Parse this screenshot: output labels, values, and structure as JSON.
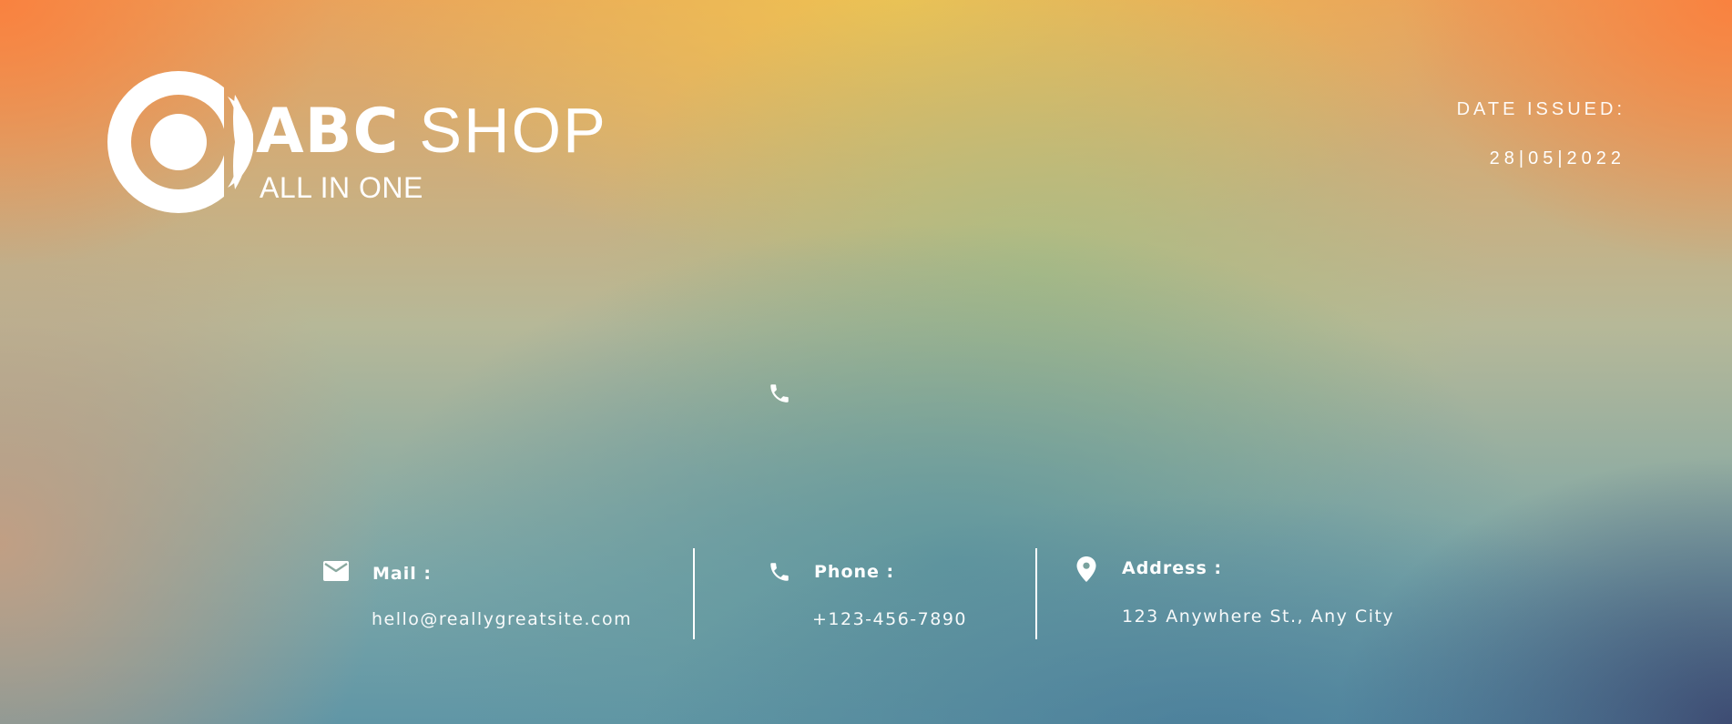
{
  "brand": {
    "name_bold": "ABC",
    "name_light": "SHOP",
    "tagline": "ALL IN ONE",
    "logo_icon": "circle-logo-icon"
  },
  "date": {
    "label": "DATE ISSUED:",
    "value": "28|05|2022"
  },
  "contacts": {
    "mail": {
      "icon": "envelope-icon",
      "label": "Mail :",
      "value": "hello@reallygreatsite.com"
    },
    "phone": {
      "icon": "phone-icon",
      "label": "Phone :",
      "value": "+123-456-7890"
    },
    "address": {
      "icon": "location-pin-icon",
      "label": "Address :",
      "value": "123 Anywhere St., Any City"
    }
  },
  "colors": {
    "text": "#ffffff",
    "orange": "#fa803e",
    "yellow": "#eec452",
    "teal": "#5f969e",
    "navy": "#3c466e"
  }
}
